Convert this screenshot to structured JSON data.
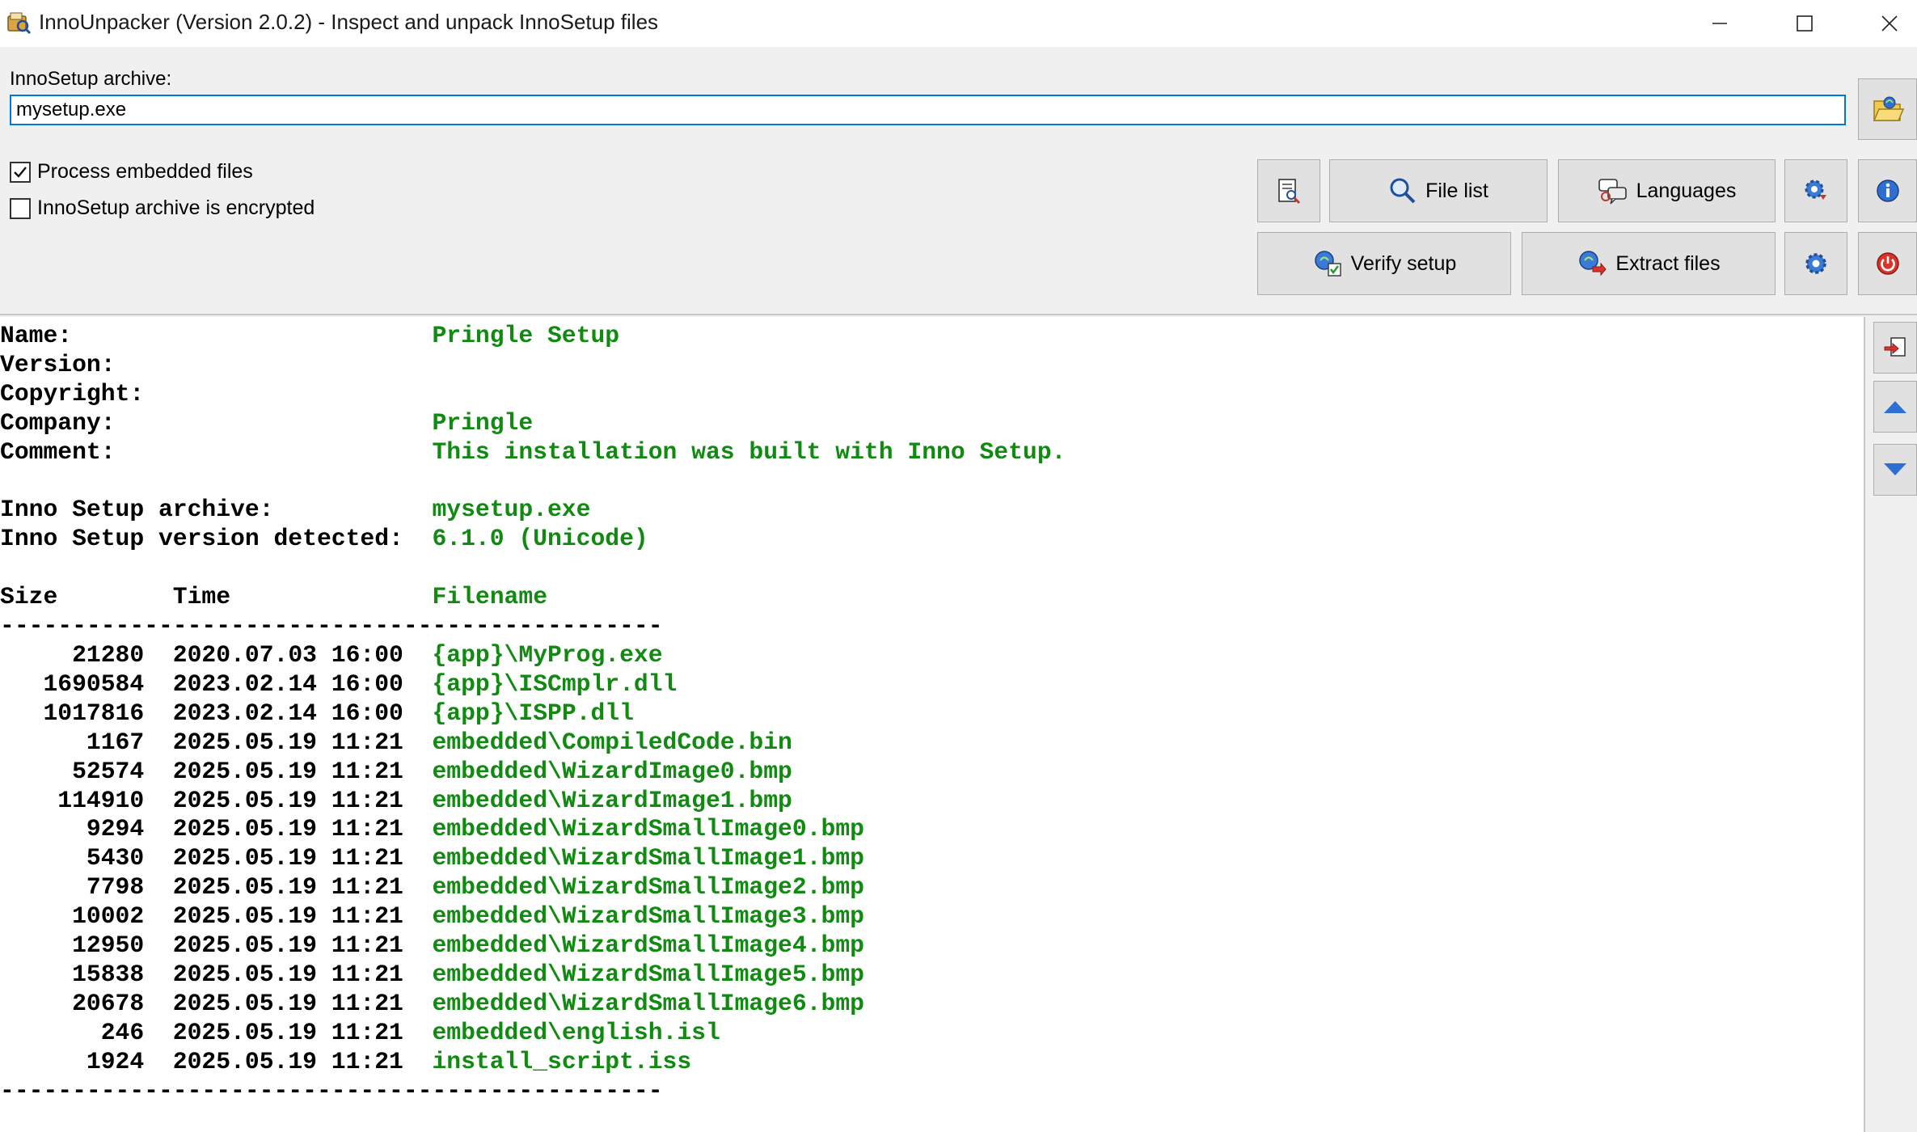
{
  "window": {
    "title": "InnoUnpacker (Version 2.0.2) - Inspect and unpack InnoSetup files"
  },
  "archive": {
    "label": "InnoSetup archive:",
    "value": "mysetup.exe"
  },
  "options": {
    "process_embedded": {
      "label": "Process embedded files",
      "checked": true
    },
    "encrypted": {
      "label": "InnoSetup archive is encrypted",
      "checked": false
    }
  },
  "buttons": {
    "file_list": "File list",
    "languages": "Languages",
    "verify_setup": "Verify setup",
    "extract_files": "Extract files"
  },
  "info": [
    {
      "label": "Name:",
      "value": "Pringle Setup"
    },
    {
      "label": "Version:",
      "value": ""
    },
    {
      "label": "Copyright:",
      "value": ""
    },
    {
      "label": "Company:",
      "value": "Pringle"
    },
    {
      "label": "Comment:",
      "value": "This installation was built with Inno Setup."
    }
  ],
  "archive_info": [
    {
      "label": "Inno Setup archive:",
      "value": "mysetup.exe"
    },
    {
      "label": "Inno Setup version detected:",
      "value": "6.1.0 (Unicode)"
    }
  ],
  "table": {
    "headers": {
      "size": "Size",
      "time": "Time",
      "filename": "Filename"
    },
    "separator": "----------------------------------------------",
    "rows": [
      {
        "size": "21280",
        "time": "2020.07.03 16:00",
        "filename": "{app}\\MyProg.exe"
      },
      {
        "size": "1690584",
        "time": "2023.02.14 16:00",
        "filename": "{app}\\ISCmplr.dll"
      },
      {
        "size": "1017816",
        "time": "2023.02.14 16:00",
        "filename": "{app}\\ISPP.dll"
      },
      {
        "size": "1167",
        "time": "2025.05.19 11:21",
        "filename": "embedded\\CompiledCode.bin"
      },
      {
        "size": "52574",
        "time": "2025.05.19 11:21",
        "filename": "embedded\\WizardImage0.bmp"
      },
      {
        "size": "114910",
        "time": "2025.05.19 11:21",
        "filename": "embedded\\WizardImage1.bmp"
      },
      {
        "size": "9294",
        "time": "2025.05.19 11:21",
        "filename": "embedded\\WizardSmallImage0.bmp"
      },
      {
        "size": "5430",
        "time": "2025.05.19 11:21",
        "filename": "embedded\\WizardSmallImage1.bmp"
      },
      {
        "size": "7798",
        "time": "2025.05.19 11:21",
        "filename": "embedded\\WizardSmallImage2.bmp"
      },
      {
        "size": "10002",
        "time": "2025.05.19 11:21",
        "filename": "embedded\\WizardSmallImage3.bmp"
      },
      {
        "size": "12950",
        "time": "2025.05.19 11:21",
        "filename": "embedded\\WizardSmallImage4.bmp"
      },
      {
        "size": "15838",
        "time": "2025.05.19 11:21",
        "filename": "embedded\\WizardSmallImage5.bmp"
      },
      {
        "size": "20678",
        "time": "2025.05.19 11:21",
        "filename": "embedded\\WizardSmallImage6.bmp"
      },
      {
        "size": "246",
        "time": "2025.05.19 11:21",
        "filename": "embedded\\english.isl"
      },
      {
        "size": "1924",
        "time": "2025.05.19 11:21",
        "filename": "install_script.iss"
      }
    ]
  },
  "colors": {
    "value_text": "#118a11",
    "accent": "#0078d7"
  },
  "icons": {
    "browse": "open-folder-icon",
    "view": "document-search-icon",
    "file_list": "magnifier-icon",
    "languages": "speech-bubbles-icon",
    "settings": "gear-icon",
    "info": "info-icon",
    "verify": "verify-check-icon",
    "extract": "extract-arrow-icon",
    "power": "power-icon",
    "copy": "copy-out-icon",
    "up": "triangle-up-icon",
    "down": "triangle-down-icon"
  }
}
